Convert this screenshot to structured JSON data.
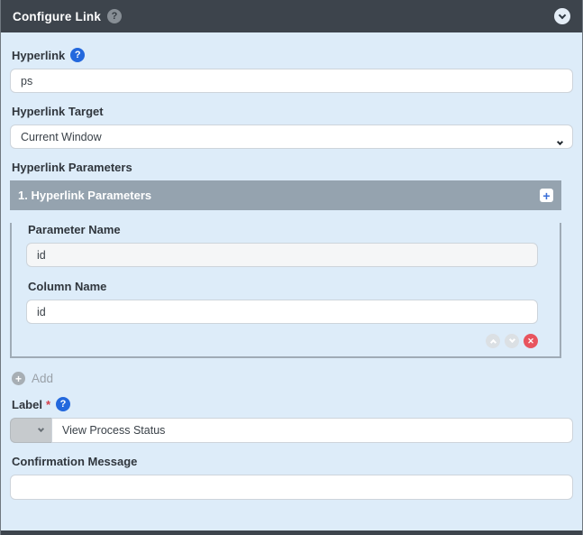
{
  "colors": {
    "header_bg": "#3d444c",
    "page_bg": "#ddecf9",
    "panel_header_bg": "#95a3af",
    "help_icon_blue": "#2368dd",
    "danger_red": "#e8545e",
    "required_red": "#d43f4a"
  },
  "icons": {
    "help_glyph": "?",
    "plus_glyph": "+",
    "remove_glyph": "✕",
    "add_glyph": "+"
  },
  "header": {
    "title": "Configure Link"
  },
  "form": {
    "hyperlink": {
      "label": "Hyperlink",
      "value": "ps"
    },
    "hyperlink_target": {
      "label": "Hyperlink Target",
      "selected_option": "Current Window"
    },
    "hyperlink_parameters_label": "Hyperlink Parameters",
    "label_field": {
      "label": "Label",
      "required_mark": "*",
      "value": "View Process Status"
    },
    "confirmation_message": {
      "label": "Confirmation Message",
      "value": ""
    }
  },
  "parameters_panel": {
    "title": "1. Hyperlink Parameters",
    "parameter_name": {
      "label": "Parameter Name",
      "value": "id"
    },
    "column_name": {
      "label": "Column Name",
      "value": "id"
    }
  },
  "add_button_label": "Add"
}
